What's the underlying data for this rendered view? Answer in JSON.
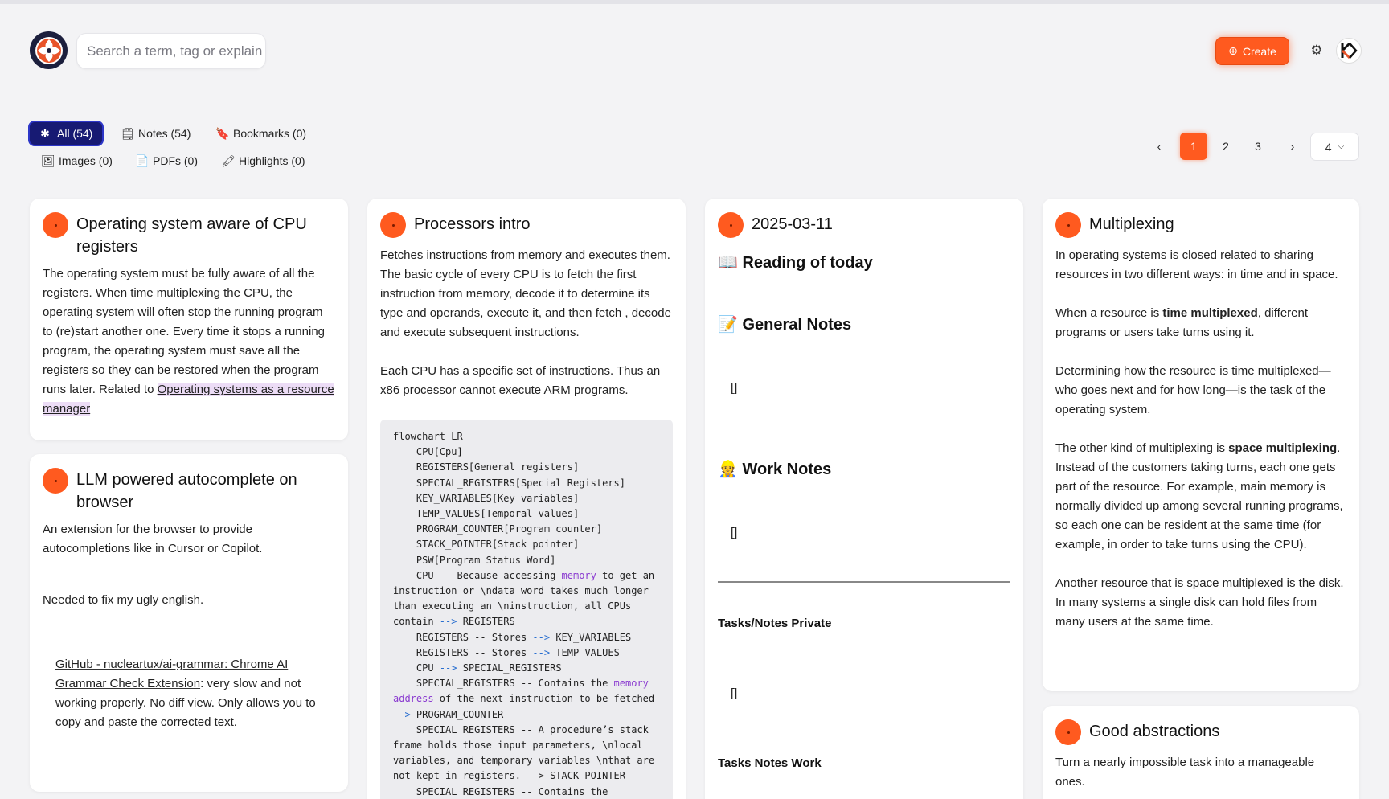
{
  "header": {
    "search_placeholder": "Search a term, tag or explain",
    "create_label": "Create",
    "avatar_initials": "K"
  },
  "filters": {
    "all": "All (54)",
    "notes": "Notes (54)",
    "bookmarks": "Bookmarks (0)",
    "images": "Images (0)",
    "pdfs": "PDFs (0)",
    "highlights": "Highlights (0)"
  },
  "pagination": {
    "pages": [
      "1",
      "2",
      "3"
    ],
    "current": "1",
    "page_size": "4"
  },
  "cards": {
    "os_cpu": {
      "title": "Operating system aware of CPU registers",
      "text": "The operating system must be fully aware of all the registers. When time multiplexing the CPU, the operating system will often stop the running program to (re)start another one. Every time it stops a running program, the operating system must save all the registers so they can be restored when the program runs later. Related to ",
      "link": "Operating systems as a resource manager"
    },
    "llm": {
      "title": "LLM powered autocomplete on browser",
      "p1": "An extension for the browser to provide autocompletions like in Cursor or Copilot.",
      "p2": "Needed to fix my ugly english.",
      "link": "GitHub - nucleartux/ai-grammar: Chrome AI Grammar Check Extension",
      "p3": ": very slow and not working properly. No diff view. Only allows you to copy and paste the corrected text."
    },
    "processors": {
      "title": "Processors intro",
      "p1": "Fetches instructions from memory and executes them. The basic cycle of every CPU is to fetch the first instruction from memory, decode it to determine its type and operands, execute it, and then fetch , decode and execute subsequent instructions.",
      "p2": "Each CPU has a specific set of instructions. Thus an x86 processor cannot execute ARM programs."
    },
    "daily": {
      "title": "2025-03-11",
      "reading": "📖 Reading of today",
      "general": "📝 General Notes",
      "empty1": "[]",
      "work": "👷 Work Notes",
      "empty2": "[]",
      "tasks_private": "Tasks/Notes Private",
      "empty3": "[]",
      "tasks_work": "Tasks Notes Work"
    },
    "multiplexing": {
      "title": "Multiplexing",
      "p1": "In operating systems is closed related to sharing resources in two different ways: in time and in space.",
      "p2_a": "When a resource is ",
      "p2_b": "time multiplexed",
      "p2_c": ", different programs or users take turns using it.",
      "p3": "Determining how the resource is time multiplexed—who goes next and for how long—is the task of the operating system.",
      "p4_a": "The other kind of multiplexing is ",
      "p4_b": "space multiplexing",
      "p4_c": ". Instead of the customers taking turns, each one gets part of the resource. For example, main memory is normally divided up among several running programs, so each one can be resident at the same time (for example, in order to take turns using the CPU).",
      "p5": "Another resource that is space multiplexed is the disk. In many systems a single disk can hold files from many users at the same time."
    },
    "abstractions": {
      "title": "Good abstractions",
      "p1": "Turn a nearly impossible task into a manageable ones."
    }
  },
  "code": {
    "l1": "flowchart LR",
    "l2": "    CPU[Cpu]",
    "l3": "    REGISTERS[General registers]",
    "l4": "    SPECIAL_REGISTERS[Special Registers]",
    "l5": "    KEY_VARIABLES[Key variables]",
    "l6": "    TEMP_VALUES[Temporal values]",
    "l7": "    PROGRAM_COUNTER[Program counter]",
    "l8": "    STACK_POINTER[Stack pointer]",
    "l9": "    PSW[Program Status Word]",
    "l10a": "    CPU -- Because accessing ",
    "kw_memory": "memory",
    "l10b": " to get an instruction or \\ndata word takes much longer than executing an \\ninstruction, all CPUs contain ",
    "arrow": "-->",
    "l10c": " REGISTERS",
    "l11a": "    REGISTERS -- Stores ",
    "l11b": " KEY_VARIABLES",
    "l12a": "    REGISTERS -- Stores ",
    "l12b": " TEMP_VALUES",
    "l13a": "    CPU ",
    "l13b": " SPECIAL_REGISTERS",
    "l14a": "    SPECIAL_REGISTERS -- Contains the ",
    "kw_memory_address": "memory address",
    "l14b": " of the next instruction to be fetched ",
    "l14c": " PROGRAM_COUNTER",
    "l15": "    SPECIAL_REGISTERS -- A procedure’s stack frame holds those input parameters, \\nlocal variables, and temporary variables \\nthat are not kept in registers. --> STACK_POINTER",
    "l16": "    SPECIAL_REGISTERS -- Contains the"
  },
  "colors": {
    "accent": "#ff5a1f",
    "active_filter": "#171a73",
    "background": "#f3f3f5"
  }
}
